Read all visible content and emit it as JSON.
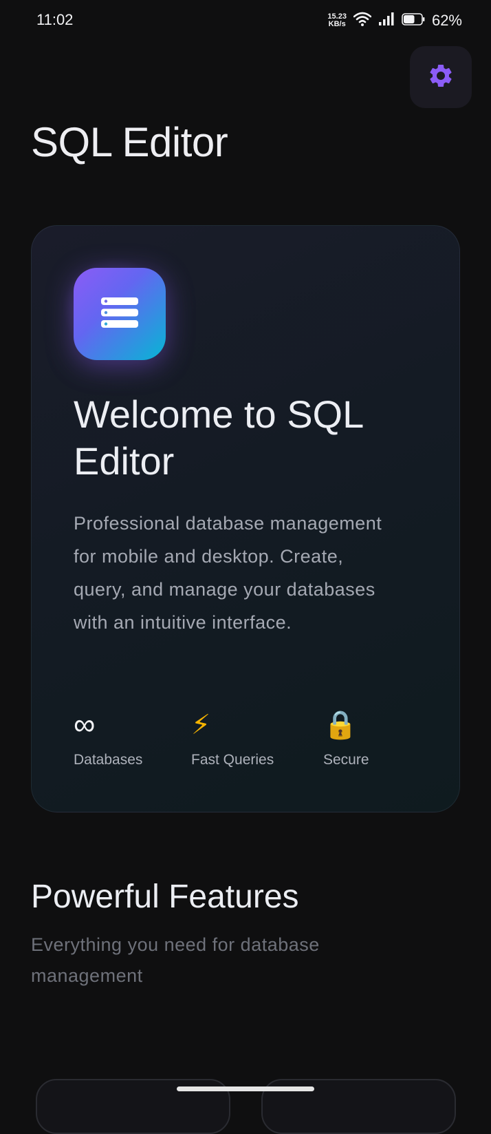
{
  "status_bar": {
    "time": "11:02",
    "net_speed_value": "15.23",
    "net_speed_unit": "KB/s",
    "battery_percent": "62%",
    "battery_level": 0.62
  },
  "header": {
    "title": "SQL Editor",
    "settings_icon": "gear-icon"
  },
  "welcome_card": {
    "logo_icon": "database-server-icon",
    "title": "Welcome to SQL Editor",
    "description": "Professional database management for mobile and desktop. Create, query, and manage your databases with an intuitive interface.",
    "stats": [
      {
        "icon": "∞",
        "icon_name": "infinity-icon",
        "label": "Databases"
      },
      {
        "icon": "⚡",
        "icon_name": "lightning-icon",
        "label": "Fast Queries"
      },
      {
        "icon": "🔒",
        "icon_name": "lock-icon",
        "label": "Secure"
      }
    ]
  },
  "features": {
    "title": "Powerful Features",
    "subtitle": "Everything you need for database management"
  },
  "colors": {
    "background": "#0f0f10",
    "accent": "#8b5cf6",
    "accent_secondary": "#06b6d4"
  }
}
